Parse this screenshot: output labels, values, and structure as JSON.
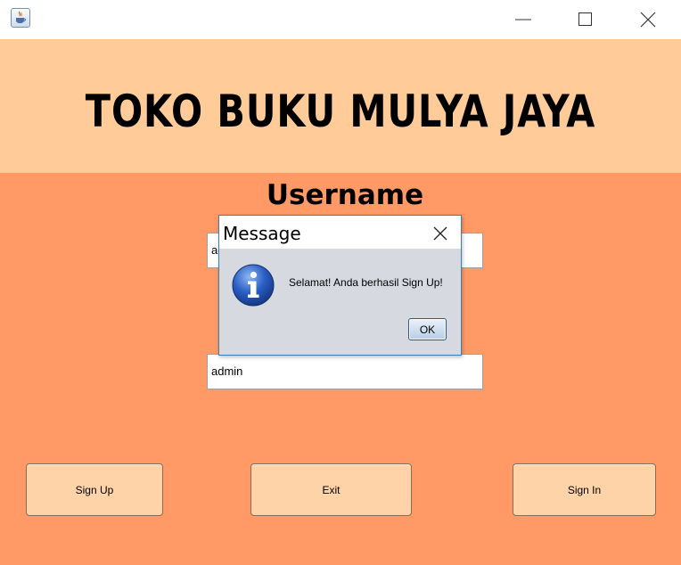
{
  "window": {
    "app_icon": "java-coffee-icon",
    "controls": [
      "minimize-icon",
      "maximize-icon",
      "close-icon"
    ]
  },
  "banner": {
    "title": "TOKO BUKU MULYA JAYA"
  },
  "form": {
    "username_label": "Username",
    "username_value": "admin",
    "password_value": "admin"
  },
  "buttons": {
    "signup": "Sign Up",
    "exit": "Exit",
    "signin": "Sign In"
  },
  "dialog": {
    "title": "Message",
    "message": "Selamat! Anda berhasil Sign Up!",
    "ok_label": "OK",
    "icon": "info-icon"
  },
  "colors": {
    "banner_bg": "#ffcc99",
    "body_bg": "#ff9966",
    "button_bg": "#ffd3a8"
  }
}
